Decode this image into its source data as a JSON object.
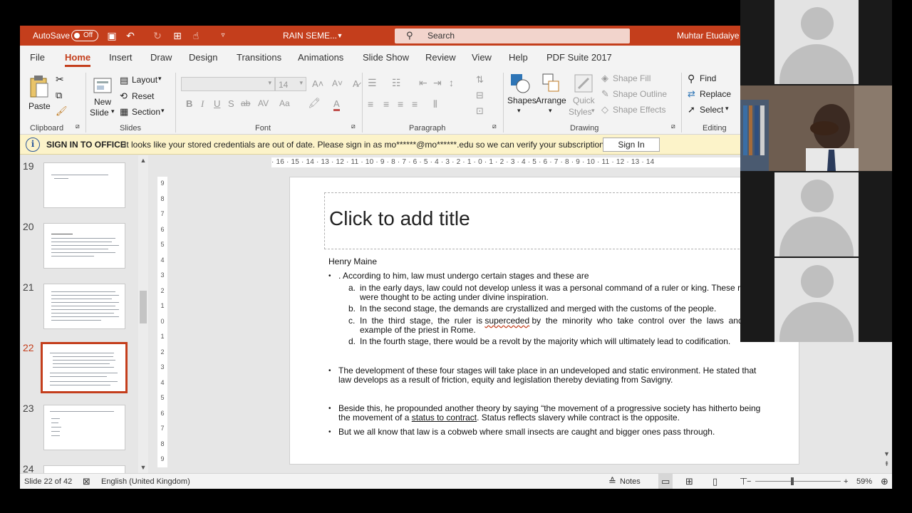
{
  "titlebar": {
    "autosave_label": "AutoSave",
    "autosave_state": "Off",
    "doc_title": "RAIN SEME...",
    "search_placeholder": "Search",
    "user_name": "Muhtar Etudaiye"
  },
  "tabs": [
    "File",
    "Home",
    "Insert",
    "Draw",
    "Design",
    "Transitions",
    "Animations",
    "Slide Show",
    "Review",
    "View",
    "Help",
    "PDF Suite 2017"
  ],
  "active_tab": "Home",
  "ribbon": {
    "clipboard": {
      "label": "Clipboard",
      "paste": "Paste"
    },
    "slides": {
      "label": "Slides",
      "new_slide_1": "New",
      "new_slide_2": "Slide",
      "layout": "Layout",
      "reset": "Reset",
      "section": "Section"
    },
    "font": {
      "label": "Font",
      "size": "14"
    },
    "paragraph": {
      "label": "Paragraph"
    },
    "drawing": {
      "label": "Drawing",
      "shapes": "Shapes",
      "arrange": "Arrange",
      "quick_styles_1": "Quick",
      "quick_styles_2": "Styles",
      "shape_fill": "Shape Fill",
      "shape_outline": "Shape Outline",
      "shape_effects": "Shape Effects"
    },
    "editing": {
      "label": "Editing",
      "find": "Find",
      "replace": "Replace",
      "select": "Select"
    }
  },
  "notification": {
    "title": "SIGN IN TO OFFICE",
    "message": "It looks like your stored credentials are out of date. Please sign in as mo******@mo******.edu so we can verify your subscription.",
    "button": "Sign In"
  },
  "slide_panel": {
    "numbers": [
      "19",
      "20",
      "21",
      "22",
      "23",
      "24"
    ],
    "active": "22"
  },
  "ruler": {
    "horizontal": "· 16 · 15 · 14 · 13 · 12 · 11 · 10 · 9 · 8 · 7 · 6 · 5 · 4 · 3 · 2 · 1 · 0 · 1 · 2 · 3 · 4 · 5 · 6 · 7 · 8 · 9 · 10 · 11 · 12 · 13 · 14",
    "vertical": [
      "9",
      "8",
      "7",
      "6",
      "5",
      "4",
      "3",
      "2",
      "1",
      "0",
      "1",
      "2",
      "3",
      "4",
      "5",
      "6",
      "7",
      "8",
      "9"
    ]
  },
  "slide": {
    "title_placeholder": "Click to add title",
    "heading": "Henry Maine",
    "bullet1": ". According to him, law must undergo certain stages and these are",
    "items": [
      {
        "marker": "a.",
        "line1": "in the early days, law could not develop unless it was a personal command of a ruler or king. These rulers",
        "line2": "were thought to be acting under divine inspiration."
      },
      {
        "marker": "b.",
        "line1": "In the second stage, the demands are crystallized and merged with the customs of the people.",
        "line2": ""
      },
      {
        "marker": "c.",
        "line1_pre": "In  the  third  stage,  the  ruler  is ",
        "line1_word": "superceded",
        "line1_post": " by  the  minority  who  take  control  over  the  laws  and  he  gave",
        "line2": "example of the priest in Rome."
      },
      {
        "marker": "d.",
        "line1": "In the fourth stage, there would be a revolt by the majority which will ultimately lead to codification.",
        "line2": ""
      }
    ],
    "bullet2_line1": "The development of these four stages will take place in an undeveloped and static environment. He stated that",
    "bullet2_line2": "law develops as a result of friction, equity and legislation thereby deviating from Savigny.",
    "bullet3_line1": "Beside this, he propounded another theory by saying “the movement of  a progressive society has hitherto being",
    "bullet3_line2_pre": "the movement of a ",
    "bullet3_line2_link": "status to contract",
    "bullet3_line2_post": ". Status reflects slavery while contract is the opposite.",
    "bullet4": "But we all know that law is a cobweb where small insects are caught and bigger ones pass through."
  },
  "statusbar": {
    "slide_count": "Slide 22 of 42",
    "language": "English (United Kingdom)",
    "notes": "Notes",
    "zoom": "59%"
  }
}
